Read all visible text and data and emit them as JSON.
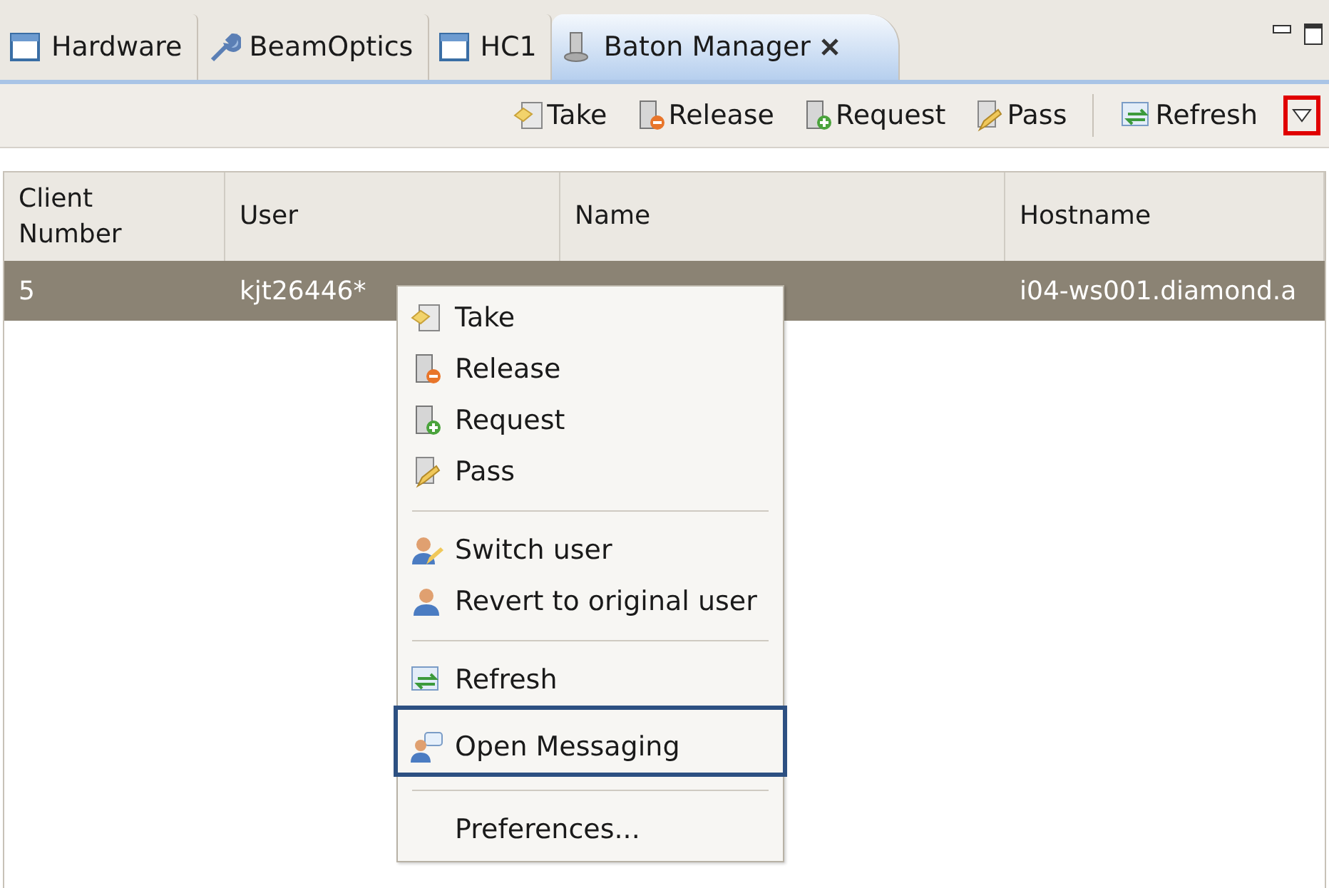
{
  "tabs": [
    {
      "label": "Hardware",
      "selected": false
    },
    {
      "label": "BeamOptics",
      "selected": false
    },
    {
      "label": "HC1",
      "selected": false
    },
    {
      "label": "Baton Manager",
      "selected": true
    }
  ],
  "toolbar": {
    "buttons": [
      {
        "label": "Take"
      },
      {
        "label": "Release"
      },
      {
        "label": "Request"
      },
      {
        "label": "Pass"
      },
      {
        "label": "Refresh"
      }
    ],
    "view_menu": {
      "annotated": true
    }
  },
  "table": {
    "columns": [
      {
        "label": "Client Number"
      },
      {
        "label": "User"
      },
      {
        "label": "Name"
      },
      {
        "label": "Hostname"
      }
    ],
    "rows": [
      {
        "selected": true,
        "cells": [
          "5",
          "kjt26446*",
          null,
          "i04-ws001.diamond.a"
        ]
      }
    ]
  },
  "context_menu": {
    "items": [
      {
        "kind": "item",
        "label": "Take"
      },
      {
        "kind": "item",
        "label": "Release"
      },
      {
        "kind": "item",
        "label": "Request"
      },
      {
        "kind": "item",
        "label": "Pass"
      },
      {
        "kind": "separator"
      },
      {
        "kind": "item",
        "label": "Switch user"
      },
      {
        "kind": "item",
        "label": "Revert to original user"
      },
      {
        "kind": "separator"
      },
      {
        "kind": "item",
        "label": "Refresh"
      },
      {
        "kind": "item",
        "label": "Open Messaging",
        "annotated": true
      },
      {
        "kind": "separator"
      },
      {
        "kind": "item",
        "label": "Preferences..."
      }
    ]
  }
}
